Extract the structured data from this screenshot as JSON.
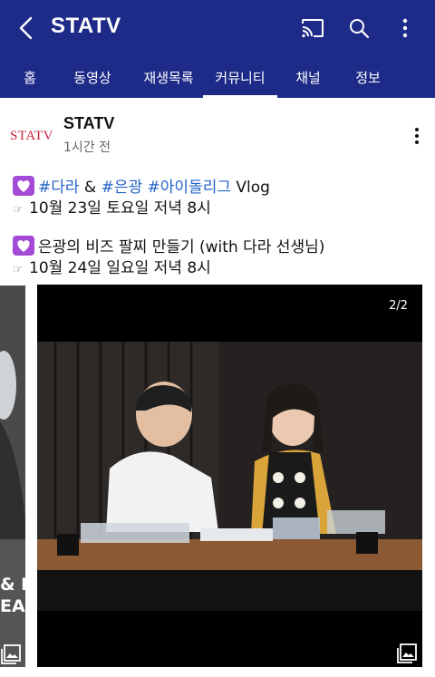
{
  "header": {
    "title": "STATV",
    "icons": [
      "back-arrow-icon",
      "cast-icon",
      "search-icon",
      "more-vert-icon"
    ]
  },
  "tabs": [
    {
      "label": "홈",
      "active": false
    },
    {
      "label": "동영상",
      "active": false
    },
    {
      "label": "재생목록",
      "active": false
    },
    {
      "label": "커뮤니티",
      "active": true
    },
    {
      "label": "채널",
      "active": false
    },
    {
      "label": "정보",
      "active": false
    }
  ],
  "post": {
    "logo_text": "STATV",
    "channel": "STATV",
    "time": "1시간 전",
    "line1": {
      "tag1": "#다라",
      "amp": " & ",
      "tag2": "#은광",
      "sp": " ",
      "tag3": "#아이돌리그",
      "suffix": " Vlog"
    },
    "line2": "10월 23일 토요일 저녁 8시",
    "line3": "은광의 비즈 팔찌 만들기 (with 다라 선생님)",
    "line4": "10월 24일 일요일 저녁 8시",
    "left_image_text": "& E\nEAC",
    "image_counter": "2/2"
  },
  "colors": {
    "appbar": "#1d2a87",
    "hashtag": "#2463c9",
    "logo": "#c8233a"
  }
}
